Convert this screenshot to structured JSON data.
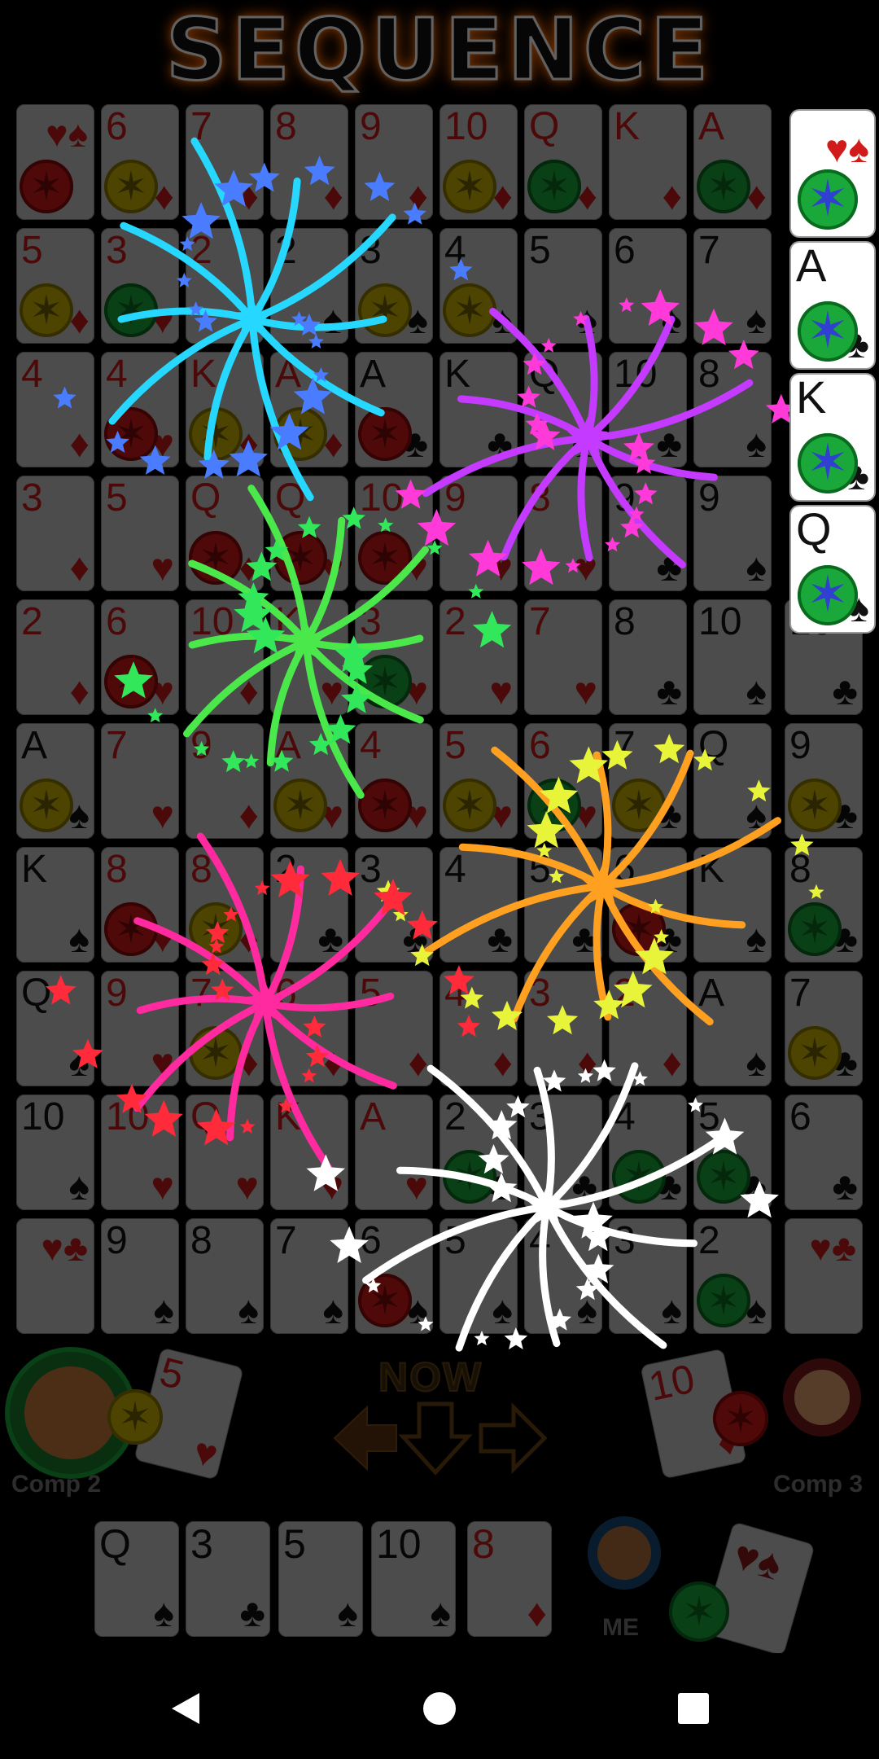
{
  "title": "SEQUENCE",
  "board": [
    [
      {
        "r": "",
        "s": "♥♠",
        "c": "corner",
        "chip": "red"
      },
      {
        "r": "6",
        "s": "♦",
        "c": "red",
        "chip": "yellow"
      },
      {
        "r": "7",
        "s": "♦",
        "c": "red"
      },
      {
        "r": "8",
        "s": "♦",
        "c": "red"
      },
      {
        "r": "9",
        "s": "♦",
        "c": "red"
      },
      {
        "r": "10",
        "s": "♦",
        "c": "red",
        "chip": "yellow"
      },
      {
        "r": "Q",
        "s": "♦",
        "c": "red",
        "chip": "green"
      },
      {
        "r": "K",
        "s": "♦",
        "c": "red"
      },
      {
        "r": "A",
        "s": "♦",
        "c": "red",
        "chip": "green"
      }
    ],
    [
      {
        "r": "5",
        "s": "♦",
        "c": "red",
        "chip": "yellow"
      },
      {
        "r": "3",
        "s": "♥",
        "c": "red",
        "chip": "green"
      },
      {
        "r": "2",
        "s": "♥",
        "c": "red"
      },
      {
        "r": "2",
        "s": "♠",
        "c": "blk"
      },
      {
        "r": "3",
        "s": "♠",
        "c": "blk",
        "chip": "yellow"
      },
      {
        "r": "4",
        "s": "♠",
        "c": "blk",
        "chip": "yellow"
      },
      {
        "r": "5",
        "s": "♠",
        "c": "blk"
      },
      {
        "r": "6",
        "s": "♠",
        "c": "blk"
      },
      {
        "r": "7",
        "s": "♠",
        "c": "blk"
      }
    ],
    [
      {
        "r": "4",
        "s": "♦",
        "c": "red"
      },
      {
        "r": "4",
        "s": "♥",
        "c": "red",
        "chip": "red"
      },
      {
        "r": "K",
        "s": "♦",
        "c": "red",
        "chip": "yellow"
      },
      {
        "r": "A",
        "s": "♦",
        "c": "red",
        "chip": "yellow"
      },
      {
        "r": "A",
        "s": "♣",
        "c": "blk",
        "chip": "red"
      },
      {
        "r": "K",
        "s": "♣",
        "c": "blk"
      },
      {
        "r": "Q",
        "s": "♣",
        "c": "blk"
      },
      {
        "r": "10",
        "s": "♣",
        "c": "blk"
      },
      {
        "r": "8",
        "s": "♠",
        "c": "blk"
      }
    ],
    [
      {
        "r": "3",
        "s": "♦",
        "c": "red"
      },
      {
        "r": "5",
        "s": "♥",
        "c": "red"
      },
      {
        "r": "Q",
        "s": "♦",
        "c": "red",
        "chip": "red"
      },
      {
        "r": "Q",
        "s": "♥",
        "c": "red",
        "chip": "red"
      },
      {
        "r": "10",
        "s": "♥",
        "c": "red",
        "chip": "red"
      },
      {
        "r": "9",
        "s": "♥",
        "c": "red"
      },
      {
        "r": "8",
        "s": "♥",
        "c": "red"
      },
      {
        "r": "9",
        "s": "♣",
        "c": "blk"
      },
      {
        "r": "9",
        "s": "♠",
        "c": "blk"
      }
    ],
    [
      {
        "r": "2",
        "s": "♦",
        "c": "red"
      },
      {
        "r": "6",
        "s": "♥",
        "c": "red",
        "chip": "red"
      },
      {
        "r": "10",
        "s": "♦",
        "c": "red"
      },
      {
        "r": "K",
        "s": "♥",
        "c": "red"
      },
      {
        "r": "3",
        "s": "♥",
        "c": "red",
        "chip": "green"
      },
      {
        "r": "2",
        "s": "♥",
        "c": "red"
      },
      {
        "r": "7",
        "s": "♥",
        "c": "red"
      },
      {
        "r": "8",
        "s": "♣",
        "c": "blk"
      },
      {
        "r": "10",
        "s": "♠",
        "c": "blk"
      },
      {
        "r": "10",
        "s": "♣",
        "c": "blk"
      }
    ],
    [
      {
        "r": "A",
        "s": "♠",
        "c": "blk",
        "chip": "yellow"
      },
      {
        "r": "7",
        "s": "♥",
        "c": "red"
      },
      {
        "r": "9",
        "s": "♦",
        "c": "red"
      },
      {
        "r": "A",
        "s": "♥",
        "c": "red",
        "chip": "yellow"
      },
      {
        "r": "4",
        "s": "♥",
        "c": "red",
        "chip": "red"
      },
      {
        "r": "5",
        "s": "♥",
        "c": "red",
        "chip": "yellow"
      },
      {
        "r": "6",
        "s": "♥",
        "c": "red",
        "chip": "green"
      },
      {
        "r": "7",
        "s": "♣",
        "c": "blk",
        "chip": "yellow"
      },
      {
        "r": "Q",
        "s": "♠",
        "c": "blk"
      },
      {
        "r": "9",
        "s": "♣",
        "c": "blk",
        "chip": "yellow"
      }
    ],
    [
      {
        "r": "K",
        "s": "♠",
        "c": "blk"
      },
      {
        "r": "8",
        "s": "♥",
        "c": "red",
        "chip": "red"
      },
      {
        "r": "8",
        "s": "♦",
        "c": "red",
        "chip": "yellow"
      },
      {
        "r": "2",
        "s": "♣",
        "c": "blk"
      },
      {
        "r": "3",
        "s": "♣",
        "c": "blk"
      },
      {
        "r": "4",
        "s": "♣",
        "c": "blk"
      },
      {
        "r": "5",
        "s": "♣",
        "c": "blk"
      },
      {
        "r": "6",
        "s": "♣",
        "c": "blk",
        "chip": "red"
      },
      {
        "r": "K",
        "s": "♠",
        "c": "blk"
      },
      {
        "r": "8",
        "s": "♣",
        "c": "blk",
        "chip": "green"
      }
    ],
    [
      {
        "r": "Q",
        "s": "♠",
        "c": "blk"
      },
      {
        "r": "9",
        "s": "♥",
        "c": "red"
      },
      {
        "r": "7",
        "s": "♦",
        "c": "red",
        "chip": "yellow"
      },
      {
        "r": "6",
        "s": "♦",
        "c": "red"
      },
      {
        "r": "5",
        "s": "♦",
        "c": "red"
      },
      {
        "r": "4",
        "s": "♦",
        "c": "red"
      },
      {
        "r": "3",
        "s": "♦",
        "c": "red"
      },
      {
        "r": "2",
        "s": "♦",
        "c": "red"
      },
      {
        "r": "A",
        "s": "♠",
        "c": "blk"
      },
      {
        "r": "7",
        "s": "♣",
        "c": "blk",
        "chip": "yellow"
      }
    ],
    [
      {
        "r": "10",
        "s": "♠",
        "c": "blk"
      },
      {
        "r": "10",
        "s": "♥",
        "c": "red"
      },
      {
        "r": "Q",
        "s": "♥",
        "c": "red"
      },
      {
        "r": "K",
        "s": "♥",
        "c": "red"
      },
      {
        "r": "A",
        "s": "♥",
        "c": "red"
      },
      {
        "r": "2",
        "s": "♣",
        "c": "blk",
        "chip": "green"
      },
      {
        "r": "3",
        "s": "♣",
        "c": "blk"
      },
      {
        "r": "4",
        "s": "♣",
        "c": "blk",
        "chip": "green"
      },
      {
        "r": "5",
        "s": "♣",
        "c": "blk",
        "chip": "green"
      },
      {
        "r": "6",
        "s": "♣",
        "c": "blk"
      }
    ],
    [
      {
        "r": "",
        "s": "♥♣",
        "c": "corner"
      },
      {
        "r": "9",
        "s": "♠",
        "c": "blk"
      },
      {
        "r": "8",
        "s": "♠",
        "c": "blk"
      },
      {
        "r": "7",
        "s": "♠",
        "c": "blk"
      },
      {
        "r": "6",
        "s": "♠",
        "c": "blk",
        "chip": "red"
      },
      {
        "r": "5",
        "s": "♠",
        "c": "blk"
      },
      {
        "r": "4",
        "s": "♠",
        "c": "blk"
      },
      {
        "r": "3",
        "s": "♠",
        "c": "blk"
      },
      {
        "r": "2",
        "s": "♠",
        "c": "blk",
        "chip": "green"
      },
      {
        "r": "",
        "s": "♥♣",
        "c": "corner"
      }
    ]
  ],
  "side_cards": [
    {
      "r": "",
      "s": "♥♠",
      "chip": "green"
    },
    {
      "r": "A",
      "s": "♣",
      "chip": "green"
    },
    {
      "r": "K",
      "s": "♣",
      "chip": "green"
    },
    {
      "r": "Q",
      "s": "♠",
      "chip": "green"
    }
  ],
  "players": {
    "left": {
      "name": "Comp 2",
      "card_rank": "5",
      "card_suit": "♥",
      "chip": "yellow"
    },
    "right": {
      "name": "Comp 3",
      "card_rank": "10",
      "card_suit": "♦",
      "chip": "red"
    },
    "me": {
      "name": "ME",
      "chip": "green"
    }
  },
  "turn_label": "NOW",
  "hand": [
    {
      "r": "Q",
      "s": "♠",
      "c": "blk"
    },
    {
      "r": "3",
      "s": "♣",
      "c": "blk"
    },
    {
      "r": "5",
      "s": "♠",
      "c": "blk"
    },
    {
      "r": "10",
      "s": "♠",
      "c": "blk"
    },
    {
      "r": "8",
      "s": "♦",
      "c": "red"
    }
  ],
  "discard": {
    "s": "♥♠"
  },
  "colors": {
    "yellow": "#c9b300",
    "red": "#d11a1a",
    "green": "#1aa83a",
    "accent": "#ff6a00"
  }
}
